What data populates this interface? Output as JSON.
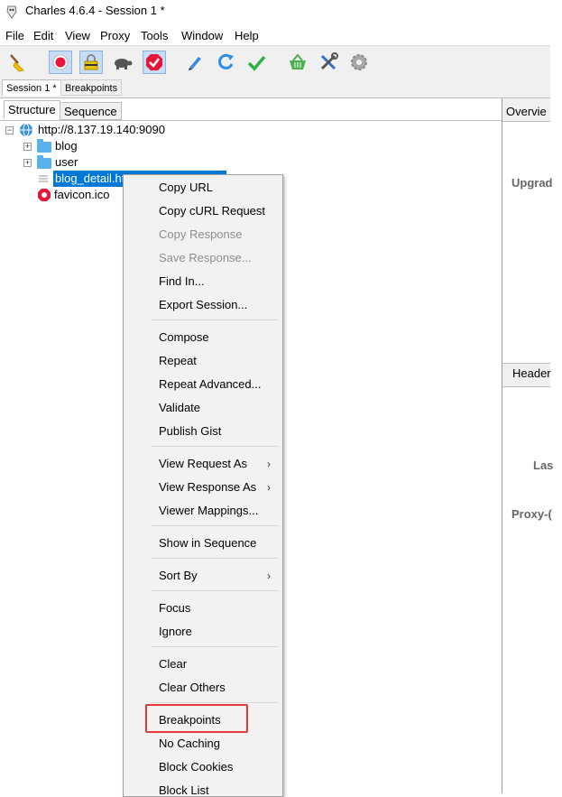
{
  "window": {
    "title": "Charles 4.6.4 - Session 1 *"
  },
  "menubar": [
    "File",
    "Edit",
    "View",
    "Proxy",
    "Tools",
    "Window",
    "Help"
  ],
  "toolbar": {
    "buttons": [
      "broom-icon",
      "record-icon",
      "ssl-proxy-lock-icon",
      "throttle-turtle-icon",
      "breakpoints-icon",
      "edit-pen-icon",
      "repeat-refresh-icon",
      "validate-check-icon",
      "basket-icon",
      "tools-icon",
      "settings-gear-icon"
    ]
  },
  "session_tabs": [
    "Session 1 *",
    "Breakpoints"
  ],
  "left_tabs": [
    "Structure",
    "Sequence"
  ],
  "tree": {
    "host": "http://8.137.19.140:9090",
    "children": [
      "blog",
      "user",
      "blog_detail.ht",
      "favicon.ico"
    ]
  },
  "right_panel": {
    "tab_top": "Overvie",
    "label_upgrade": "Upgrad",
    "tab_headers": "Header",
    "label_last": "Las",
    "label_proxy": "Proxy-("
  },
  "context_menu": {
    "items": [
      "Copy URL",
      "Copy cURL Request",
      "Copy Response",
      "Save Response...",
      "Find In...",
      "Export Session...",
      "Compose",
      "Repeat",
      "Repeat Advanced...",
      "Validate",
      "Publish Gist",
      "View Request As",
      "View Response As",
      "Viewer Mappings...",
      "Show in Sequence",
      "Sort By",
      "Focus",
      "Ignore",
      "Clear",
      "Clear Others",
      "Breakpoints",
      "No Caching",
      "Block Cookies",
      "Block List"
    ],
    "disabled": [
      "Copy Response",
      "Save Response..."
    ],
    "submenu_arrow": "›"
  },
  "colors": {
    "selection": "#0078d7",
    "highlight_box": "#e53935",
    "folder": "#5ab1ef"
  }
}
